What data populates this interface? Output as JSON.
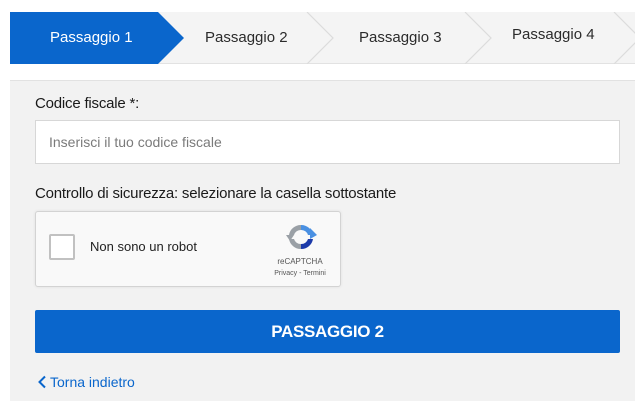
{
  "stepper": {
    "steps": [
      {
        "label": "Passaggio 1",
        "active": true
      },
      {
        "label": "Passaggio 2",
        "active": false
      },
      {
        "label": "Passaggio 3",
        "active": false
      },
      {
        "label": "Passaggio 4",
        "active": false
      }
    ],
    "active_color": "#0a66cc"
  },
  "form": {
    "codice_fiscale": {
      "label": "Codice fiscale *:",
      "value": "",
      "placeholder": "Inserisci il tuo codice fiscale"
    },
    "security_label": "Controllo di sicurezza: selezionare la casella sottostante",
    "captcha": {
      "checkbox_label": "Non sono un robot",
      "checked": false,
      "brand": "reCAPTCHA",
      "privacy": "Privacy",
      "separator": " - ",
      "terms": "Termini",
      "icon": "recaptcha-logo-icon"
    },
    "submit_label": "PASSAGGIO 2",
    "back_label": "Torna indietro",
    "back_icon": "chevron-left-icon"
  },
  "colors": {
    "primary": "#0a66cc",
    "panel_bg": "#f2f2f2"
  }
}
